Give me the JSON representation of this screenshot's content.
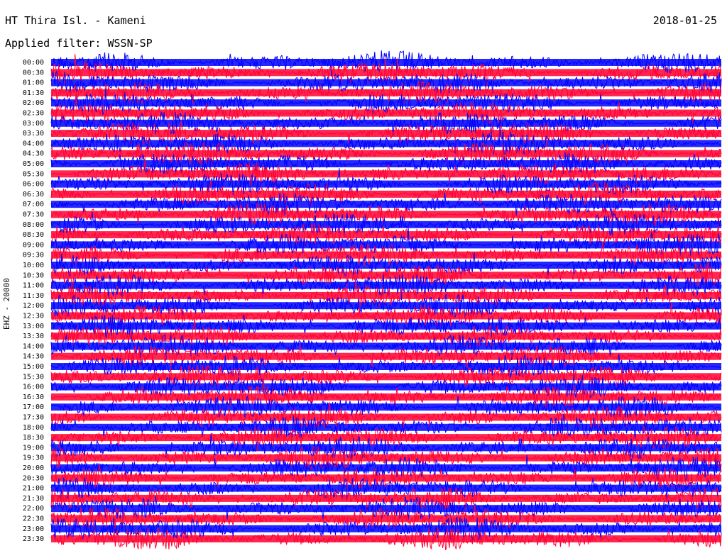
{
  "header": {
    "station": "HT Thira Isl. - Kameni",
    "date": "2018-01-25",
    "filter": "Applied filter: WSSN-SP"
  },
  "channel": "EHZ - 20000",
  "colors": {
    "trace_a": "#0000ff",
    "trace_b": "#ff0033",
    "background": "#ffffff",
    "text": "#000000"
  },
  "chart_data": {
    "type": "helicorder",
    "title": "HT Thira Isl. - Kameni",
    "ylabel": "EHZ - 20000",
    "ytick_labels": [
      "00:00",
      "00:30",
      "01:00",
      "01:30",
      "02:00",
      "02:30",
      "03:00",
      "03:30",
      "04:00",
      "04:30",
      "05:00",
      "05:30",
      "06:00",
      "06:30",
      "07:00",
      "07:30",
      "08:00",
      "08:30",
      "09:00",
      "09:30",
      "10:00",
      "10:30",
      "11:00",
      "11:30",
      "12:00",
      "12:30",
      "13:00",
      "13:30",
      "14:00",
      "14:30",
      "15:00",
      "15:30",
      "16:00",
      "16:30",
      "17:00",
      "17:30",
      "18:00",
      "18:30",
      "19:00",
      "19:30",
      "20:00",
      "20:30",
      "21:00",
      "21:30",
      "22:00",
      "22:30",
      "23:00",
      "23:30"
    ],
    "trace_colors_alternating": [
      "#0000ff",
      "#ff0033"
    ],
    "grid": false
  }
}
